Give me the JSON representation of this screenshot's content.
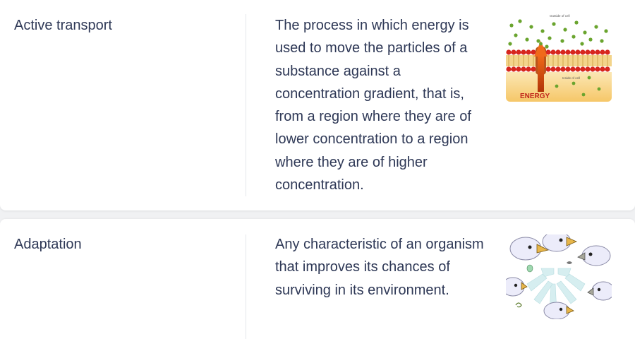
{
  "flashcards": [
    {
      "term": "Active transport",
      "definition": "The process in which energy is used to move the particles of a substance against a concentration gradient, that is, from a region where they are of lower concentration to a region where they are of higher concentration.",
      "image": {
        "icon": "cell-membrane-active-transport-illustration",
        "labels": {
          "outside": "Outside of cell",
          "inside": "Inside of cell",
          "energy": "ENERGY"
        }
      }
    },
    {
      "term": "Adaptation",
      "definition": "Any characteristic of an organism that improves its chances of surviving in its environment.",
      "image": {
        "icon": "finch-beak-adaptation-illustration"
      }
    }
  ],
  "colors": {
    "text": "#2e3856",
    "divider": "#e4e6eb",
    "background": "#f0f1f3",
    "card": "#ffffff"
  }
}
